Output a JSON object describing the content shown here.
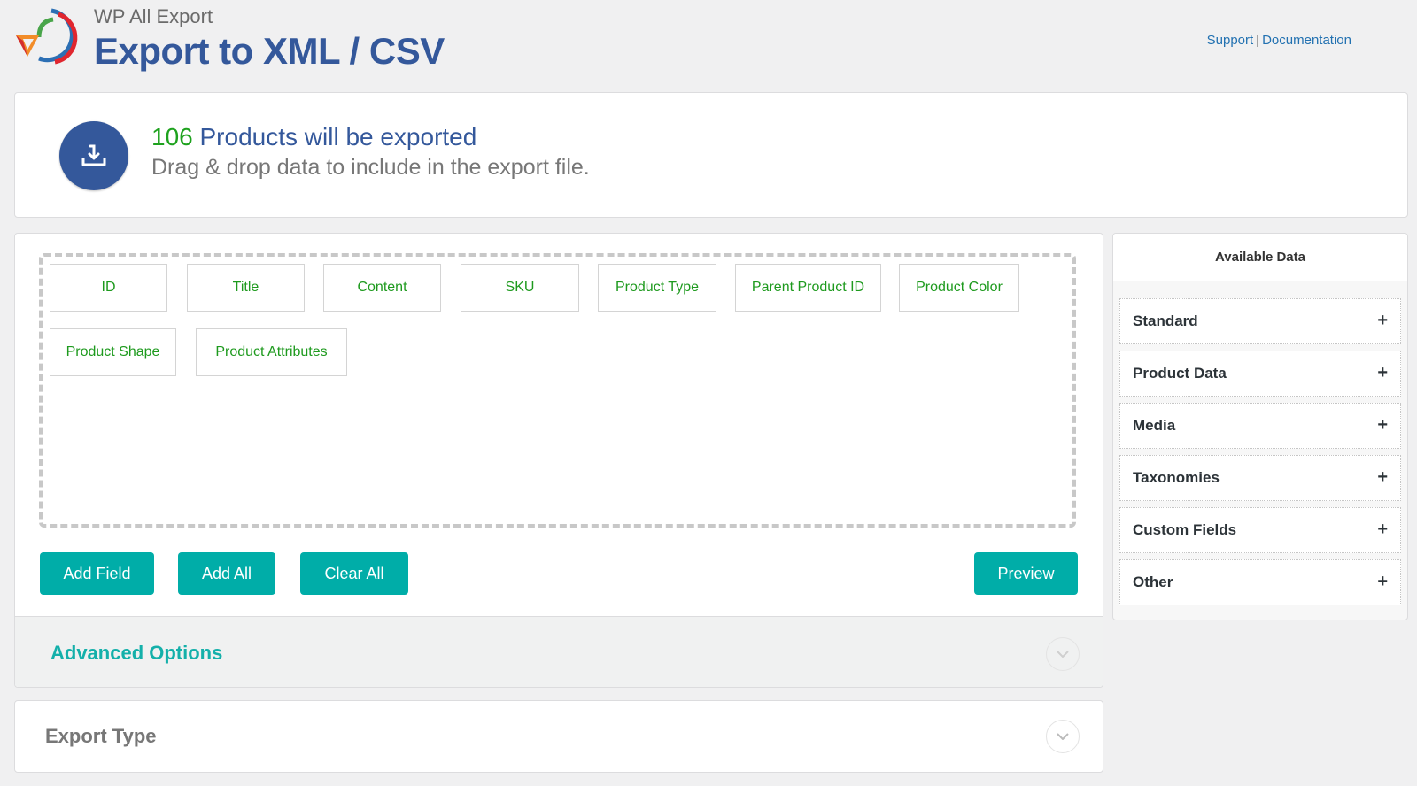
{
  "header": {
    "plugin_name": "WP All Export",
    "title": "Export to XML / CSV",
    "links": {
      "support": "Support",
      "separator": "|",
      "documentation": "Documentation"
    }
  },
  "summary": {
    "count": "106",
    "count_text": "Products will be exported",
    "subtitle": "Drag & drop data to include in the export file.",
    "icon": "download-icon"
  },
  "fields": [
    "ID",
    "Title",
    "Content",
    "SKU",
    "Product Type",
    "Parent Product ID",
    "Product Color",
    "Product Shape",
    "Product Attributes"
  ],
  "buttons": {
    "add_field": "Add Field",
    "add_all": "Add All",
    "clear_all": "Clear All",
    "preview": "Preview"
  },
  "advanced_options": {
    "label": "Advanced Options"
  },
  "export_type": {
    "label": "Export Type"
  },
  "available_data": {
    "title": "Available Data",
    "sections": [
      {
        "label": "Standard",
        "icon": "+"
      },
      {
        "label": "Product Data",
        "icon": "+"
      },
      {
        "label": "Media",
        "icon": "+"
      },
      {
        "label": "Taxonomies",
        "icon": "+"
      },
      {
        "label": "Custom Fields",
        "icon": "+"
      },
      {
        "label": "Other",
        "icon": "+"
      }
    ]
  },
  "colors": {
    "brand_blue": "#34589b",
    "count_green": "#1ea21e",
    "field_green": "#1e9a1e",
    "button_teal": "#00ada8",
    "link_blue": "#2271b1"
  }
}
